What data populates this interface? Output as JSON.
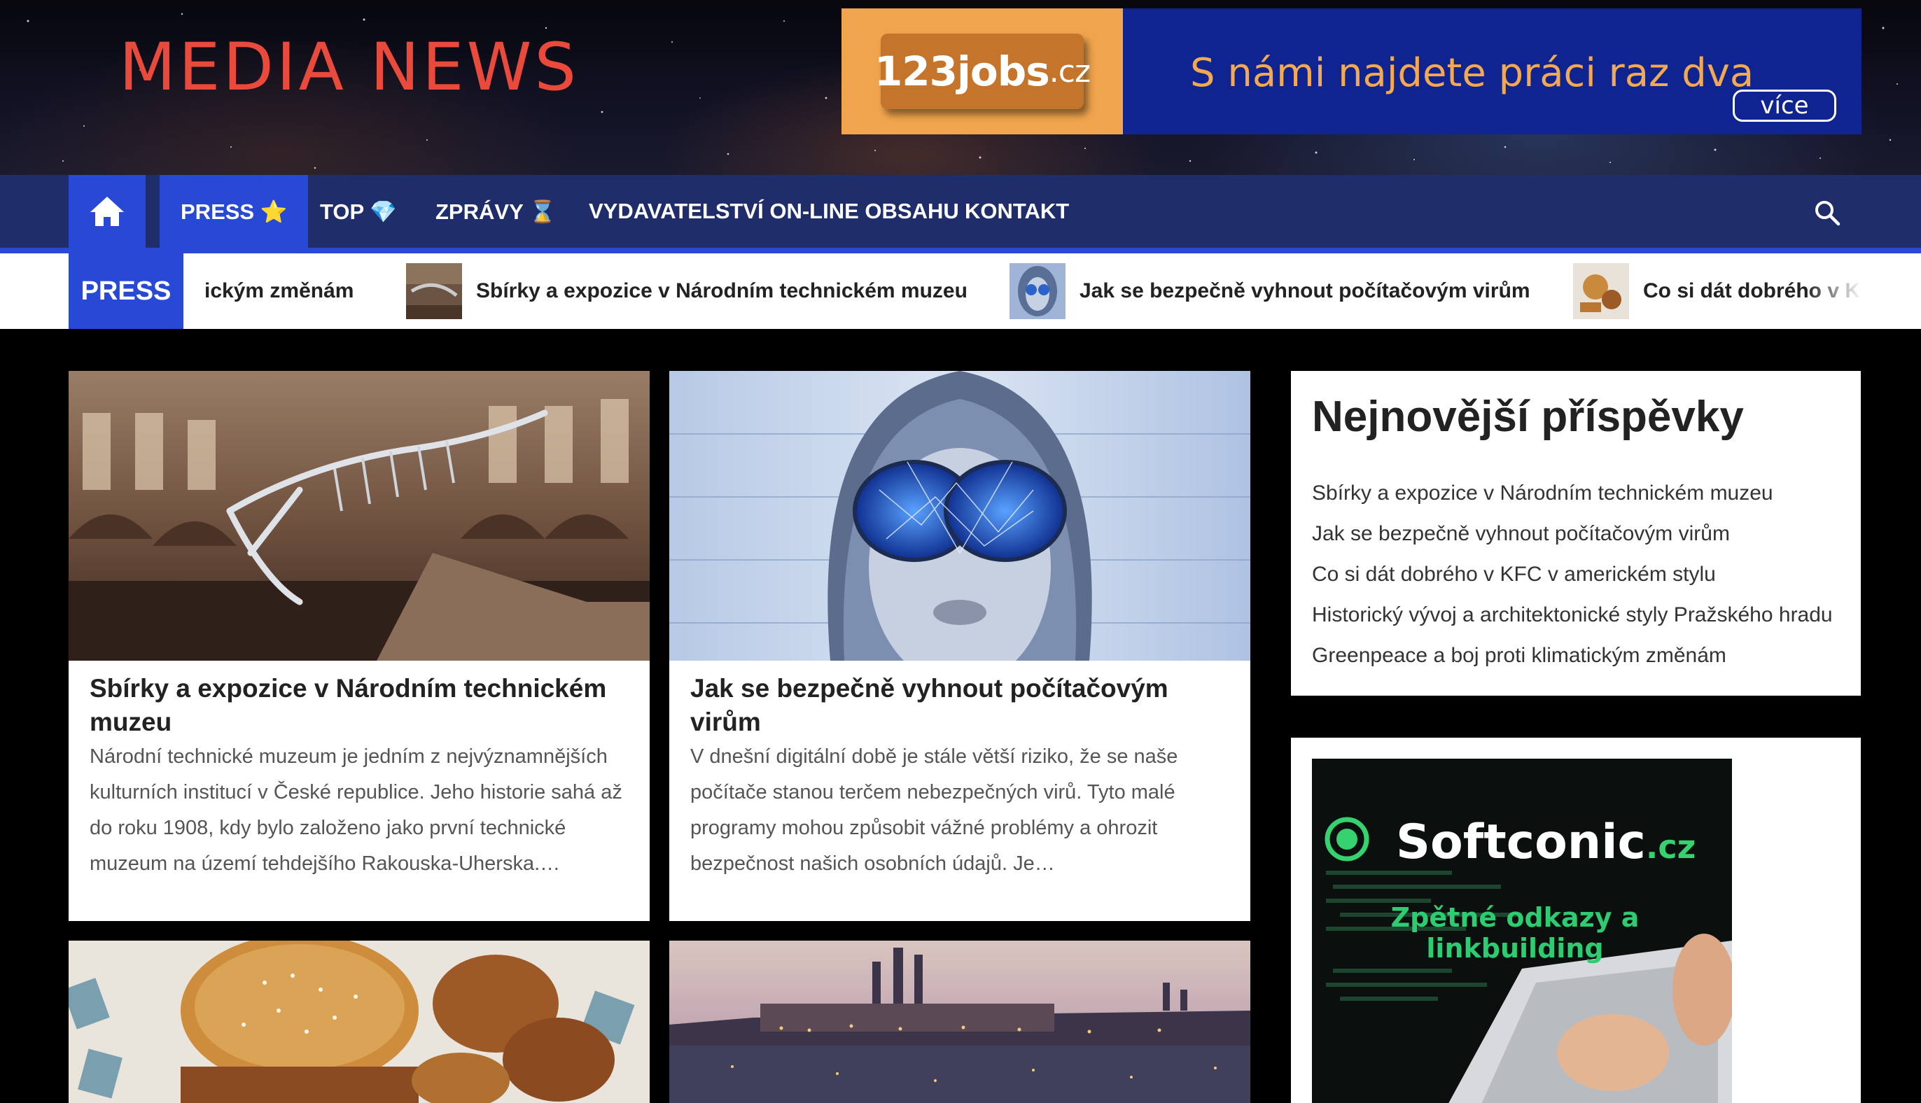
{
  "header": {
    "site_title": "MEDIA NEWS",
    "banner": {
      "logo_main": "123jobs",
      "logo_domain": ".cz",
      "slogan": "S námi najdete práci raz dva",
      "more_label": "více"
    }
  },
  "nav": {
    "items": [
      {
        "label": "PRESS ⭐"
      },
      {
        "label": "TOP 💎"
      },
      {
        "label": "ZPRÁVY ⌛"
      },
      {
        "label": "VYDAVATELSTVÍ ON-LINE OBSAHU"
      },
      {
        "label": "KONTAKT"
      }
    ]
  },
  "ticker": {
    "label": "PRESS",
    "items": [
      {
        "title": "ickým změnám"
      },
      {
        "title": "Sbírky a expozice v Národním technickém muzeu"
      },
      {
        "title": "Jak se bezpečně vyhnout počítačovým virům"
      },
      {
        "title": "Co si dát dobrého v KFC"
      }
    ]
  },
  "posts": [
    {
      "title": "Sbírky a expozice v Národním technickém muzeu",
      "excerpt": "Národní technické muzeum je jedním z nejvýznamnějších kulturních institucí v České republice. Jeho historie sahá až do roku 1908, kdy bylo založeno jako první technické muzeum na území tehdejšího Rakouska-Uherska.…"
    },
    {
      "title": "Jak se bezpečně vyhnout počítačovým virům",
      "excerpt": "V dnešní digitální době je stále větší riziko, že se naše počítače stanou terčem nebezpečných virů. Tyto malé programy mohou způsobit vážné problémy a ohrozit bezpečnost našich osobních údajů. Je…"
    }
  ],
  "sidebar": {
    "recent_title": "Nejnovější příspěvky",
    "recent_posts": [
      "Sbírky a expozice v Národním technickém muzeu",
      "Jak se bezpečně vyhnout počítačovým virům",
      "Co si dát dobrého v KFC v americkém stylu",
      "Historický vývoj a architektonické styly Pražského hradu",
      "Greenpeace a boj proti klimatickým změnám"
    ],
    "ad": {
      "brand_soft": "Soft",
      "brand_conic": "conic",
      "brand_domain": ".cz",
      "tagline_1": "Zpětné odkazy a",
      "tagline_2": "linkbuilding"
    }
  },
  "colors": {
    "site_title": "#ea4a3b",
    "nav_bg": "#1f2d6b",
    "accent": "#2749d6",
    "banner_bg": "#0f2491",
    "banner_orange": "#f0a44d",
    "ad_green": "#2ecc71"
  },
  "icons": {
    "home": "home-icon",
    "search": "search-icon"
  }
}
